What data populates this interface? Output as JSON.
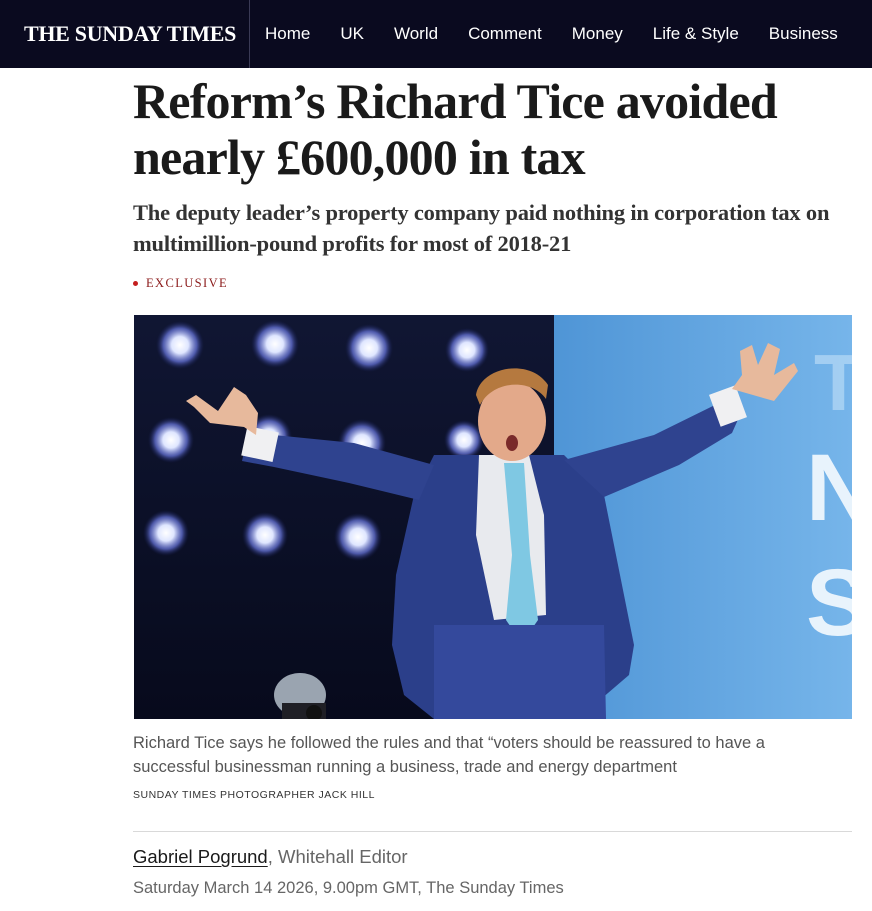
{
  "masthead": {
    "logo": "THE SUNDAY TIMES",
    "nav": [
      "Home",
      "UK",
      "World",
      "Comment",
      "Money",
      "Life & Style",
      "Business"
    ]
  },
  "article": {
    "headline": "Reform’s Richard Tice avoided nearly £600,000 in tax",
    "standfirst": "The deputy leader’s property company paid nothing in corporation tax on multimillion-pound profits for most of 2018-21",
    "label": "EXCLUSIVE",
    "image": {
      "caption": "Richard Tice says he followed the rules and that “voters should be reassured to have a successful businessman running a business, trade and energy department",
      "credit": "SUNDAY TIMES PHOTOGRAPHER JACK HILL",
      "backdrop_letters": [
        "T",
        "N",
        "S"
      ]
    },
    "author": "Gabriel Pogrund",
    "author_role": ", Whitehall Editor",
    "dateline": "Saturday March 14 2026, 9.00pm GMT, The Sunday Times"
  },
  "colors": {
    "masthead_bg": "#0a0a1f",
    "exclusive_red": "#c41e1e",
    "headline": "#1a1a1a",
    "stage_blue": "#5fa7e0",
    "suit_blue": "#2b3f8a",
    "tie": "#7fc8e3"
  }
}
